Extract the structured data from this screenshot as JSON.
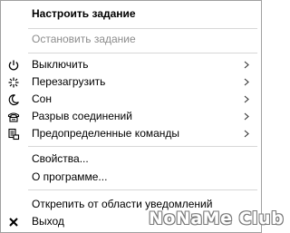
{
  "menu": {
    "items": [
      {
        "label": "Настроить задание",
        "bold": true
      },
      {
        "label": "Остановить задание",
        "disabled": true
      },
      {
        "label": "Выключить",
        "icon": "power-icon",
        "submenu": true
      },
      {
        "label": "Перезагрузить",
        "icon": "sparkle-restart-icon",
        "submenu": true
      },
      {
        "label": "Сон",
        "icon": "moon-icon",
        "submenu": true
      },
      {
        "label": "Разрыв соединений",
        "icon": "phone-disconnect-icon",
        "submenu": true
      },
      {
        "label": "Предопределенные команды",
        "icon": "command-list-icon",
        "submenu": true
      },
      {
        "label": "Свойства..."
      },
      {
        "label": "О программе..."
      },
      {
        "label": "Открепить от области уведомлений"
      },
      {
        "label": "Выход",
        "icon": "close-icon"
      }
    ]
  },
  "watermark": {
    "text": "NoNaMe Club"
  },
  "colors": {
    "disabled_text": "#8c8c8c",
    "separator": "#d7d7d7",
    "border": "#a0a0a0"
  }
}
